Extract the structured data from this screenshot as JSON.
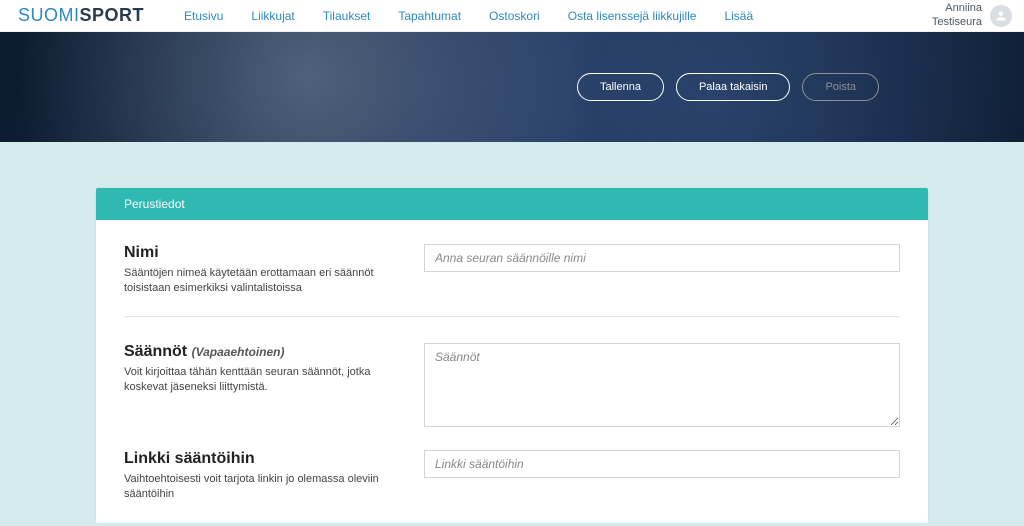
{
  "logo": {
    "left": "SUOMI",
    "right": "SPORT"
  },
  "nav": {
    "items": [
      "Etusivu",
      "Liikkujat",
      "Tilaukset",
      "Tapahtumat",
      "Ostoskori",
      "Osta lisenssejä liikkujille",
      "Lisää"
    ]
  },
  "user": {
    "name": "Anniina",
    "org": "Testiseura"
  },
  "hero": {
    "save": "Tallenna",
    "back": "Palaa takaisin",
    "delete": "Poista"
  },
  "card": {
    "header": "Perustiedot",
    "fields": {
      "name": {
        "label": "Nimi",
        "help": "Sääntöjen nimeä käytetään erottamaan eri säännöt toisistaan esimerkiksi valintalistoissa",
        "placeholder": "Anna seuran säännöille nimi"
      },
      "rules": {
        "label": "Säännöt",
        "optional": "(Vapaaehtoinen)",
        "help": "Voit kirjoittaa tähän kenttään seuran säännöt, jotka koskevat jäseneksi liittymistä.",
        "placeholder": "Säännöt"
      },
      "link": {
        "label": "Linkki sääntöihin",
        "help": "Vaihtoehtoisesti voit tarjota linkin jo olemassa oleviin sääntöihin",
        "placeholder": "Linkki sääntöihin"
      }
    }
  }
}
